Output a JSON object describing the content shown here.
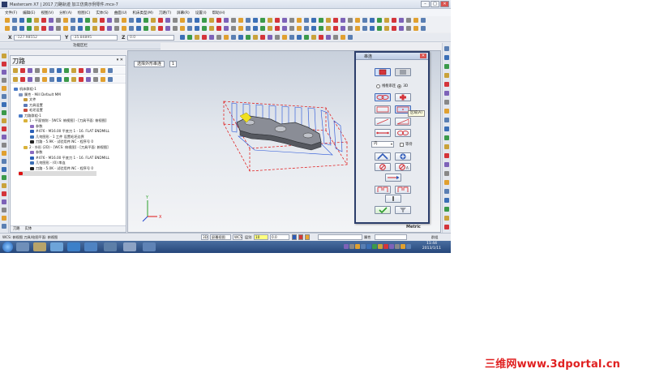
{
  "window": {
    "title": "Mastercam X7 | 2017 刀路轨迹 加工仿真示例零件.mcx-7"
  },
  "menu": {
    "items": [
      "文件(F)",
      "编辑(E)",
      "视图(V)",
      "分析(A)",
      "绘图(C)",
      "实体(S)",
      "曲面(U)",
      "机床类型(M)",
      "刀路(T)",
      "屏幕(R)",
      "设置(I)",
      "帮助(H)"
    ]
  },
  "coords": {
    "x_label": "X",
    "x_value": "-127.98552",
    "y_label": "Y",
    "y_value": "-35.84895",
    "z_label": "Z",
    "z_value": "0.0"
  },
  "function_bar": {
    "label": "功能区栏"
  },
  "toolpath_panel": {
    "title": "刀路",
    "pin": "▾ ✕",
    "tabs": [
      "刀路",
      "实体"
    ],
    "tree": [
      {
        "depth": 0,
        "label": "机床群组-1",
        "icon": "machine-group-icon",
        "color": "#4a7bc8"
      },
      {
        "depth": 1,
        "label": "属性 - Mill Default MM",
        "icon": "properties-icon",
        "color": "#7f96c2"
      },
      {
        "depth": 2,
        "label": "文件",
        "icon": "file-icon",
        "color": "#c49a3a"
      },
      {
        "depth": 2,
        "label": "刀具设置",
        "icon": "tool-settings-icon",
        "color": "#5a79b8"
      },
      {
        "depth": 2,
        "label": "毛坯设置",
        "icon": "stock-settings-icon",
        "color": "#c94a3a"
      },
      {
        "depth": 1,
        "label": "刀路群组-1",
        "icon": "toolpath-group-icon",
        "color": "#4a7bc8"
      },
      {
        "depth": 2,
        "label": "1 - 平面铣削 - [WCS: 俯视图] - [刀具平面: 俯视图]",
        "icon": "operation-folder-icon",
        "color": "#d9b23a"
      },
      {
        "depth": 3,
        "label": "参数",
        "icon": "parameters-icon",
        "color": "#8a6bc1"
      },
      {
        "depth": 3,
        "label": "#476 - M16.00 平底刀 1 - 16. FLAT ENDMILL",
        "icon": "tool-icon",
        "color": "#2a5fb8"
      },
      {
        "depth": 3,
        "label": "几何图形 - 1 工件 设置毛坯边界",
        "icon": "geometry-icon",
        "color": "#3b6fb6"
      },
      {
        "depth": 3,
        "label": "刀路 - 5.9K - 试验用件.NC - 程序号 0",
        "icon": "toolpath-icon",
        "color": "#222"
      },
      {
        "depth": 2,
        "label": "2 - 外形 (2D) - [WCS: 俯视图] - [刀具平面: 俯视图]",
        "icon": "operation-folder-icon",
        "color": "#d9b23a"
      },
      {
        "depth": 3,
        "label": "参数",
        "icon": "parameters-icon",
        "color": "#8a6bc1"
      },
      {
        "depth": 3,
        "label": "#476 - M16.00 平底刀 1 - 16. FLAT ENDMILL",
        "icon": "tool-icon",
        "color": "#2a5fb8"
      },
      {
        "depth": 3,
        "label": "几何图形 - (0) 串连",
        "icon": "geometry-icon",
        "color": "#3b6fb6"
      },
      {
        "depth": 3,
        "label": "刀路 - 5.0K - 试验用件.NC - 程序号 0",
        "icon": "toolpath-icon",
        "color": "#222"
      },
      {
        "depth": 1,
        "label": "",
        "icon": "insert-arrow-icon",
        "color": "#d11"
      }
    ]
  },
  "viewport": {
    "prompt": "选择外形串连",
    "prompt_count": "1",
    "units": "Metric",
    "axis_x": "X",
    "axis_y": "Y"
  },
  "chain_dialog": {
    "title": "串连",
    "close": "✕",
    "mode_label": "线框串连",
    "mode_option": "3D",
    "inside_value": "内",
    "wait_label": "等待",
    "tooltip": "区域(A)"
  },
  "statusbar": {
    "items": [
      "3D",
      "屏幕视图",
      "WCS",
      "层别",
      "属性",
      "群组"
    ],
    "level_value": "10",
    "z_value": "0.0"
  },
  "statusline": {
    "text": "WCS: 俯视图  刀具/绘图平面: 俯视图"
  },
  "taskbar": {
    "time": "11:44",
    "date": "2013/1/11"
  },
  "watermark": {
    "text": "三维网www.3dportal.cn"
  },
  "colors": {
    "accent": "#2c3e6b",
    "selection_red": "#e01010",
    "watermark_red": "#e02020"
  }
}
